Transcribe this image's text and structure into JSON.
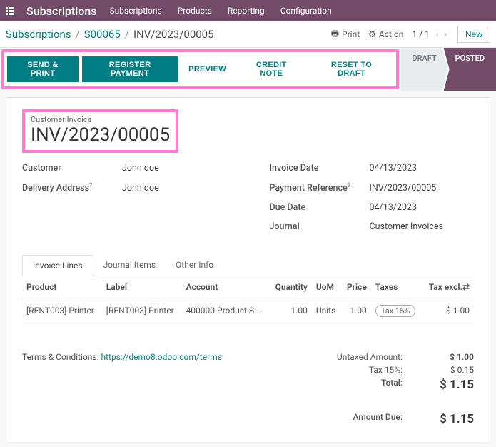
{
  "app": {
    "name": "Subscriptions"
  },
  "menu": {
    "items": [
      "Subscriptions",
      "Products",
      "Reporting",
      "Configuration"
    ]
  },
  "breadcrumbs": {
    "root": "Subscriptions",
    "mid": "S00065",
    "current": "INV/2023/00005"
  },
  "cp": {
    "print": "Print",
    "action": "Action",
    "pager": "1 / 1",
    "new": "New"
  },
  "actions": {
    "send_print": "SEND & PRINT",
    "register_payment": "REGISTER PAYMENT",
    "preview": "PREVIEW",
    "credit_note": "CREDIT NOTE",
    "reset_draft": "RESET TO DRAFT"
  },
  "status": {
    "draft": "DRAFT",
    "posted": "POSTED"
  },
  "invoice": {
    "title_label": "Customer Invoice",
    "number": "INV/2023/00005",
    "customer_label": "Customer",
    "customer": "John doe",
    "delivery_label": "Delivery Address",
    "delivery": "John doe",
    "invoice_date_label": "Invoice Date",
    "invoice_date": "04/13/2023",
    "payment_ref_label": "Payment Reference",
    "payment_ref": "INV/2023/00005",
    "due_date_label": "Due Date",
    "due_date": "04/13/2023",
    "journal_label": "Journal",
    "journal": "Customer Invoices"
  },
  "tabs": {
    "lines": "Invoice Lines",
    "journal": "Journal Items",
    "other": "Other Info"
  },
  "cols": {
    "product": "Product",
    "label": "Label",
    "account": "Account",
    "quantity": "Quantity",
    "uom": "UoM",
    "price": "Price",
    "taxes": "Taxes",
    "tax_excl": "Tax excl."
  },
  "line": {
    "product": "[RENT003] Printer",
    "label": "[RENT003] Printer",
    "account": "400000 Product S...",
    "qty": "1.00",
    "uom": "Units",
    "price": "1.00",
    "tax": "Tax 15%",
    "tax_excl": "$ 1.00"
  },
  "terms": {
    "label": "Terms & Conditions:",
    "url_text": "https://demo8.odoo.com/terms"
  },
  "totals": {
    "untaxed_label": "Untaxed Amount:",
    "untaxed": "$ 1.00",
    "tax_label": "Tax 15%:",
    "tax": "$ 0.15",
    "total_label": "Total:",
    "total": "$ 1.15",
    "due_label": "Amount Due:",
    "due": "$ 1.15"
  }
}
